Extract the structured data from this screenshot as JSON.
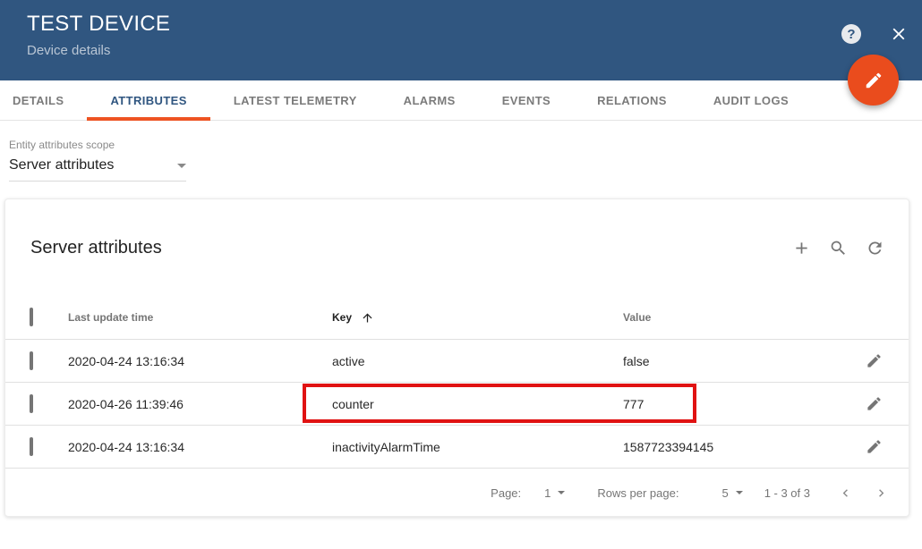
{
  "header": {
    "title": "TEST DEVICE",
    "subtitle": "Device details"
  },
  "tabs": [
    {
      "label": "DETAILS",
      "active": false
    },
    {
      "label": "ATTRIBUTES",
      "active": true
    },
    {
      "label": "LATEST TELEMETRY",
      "active": false
    },
    {
      "label": "ALARMS",
      "active": false
    },
    {
      "label": "EVENTS",
      "active": false
    },
    {
      "label": "RELATIONS",
      "active": false
    },
    {
      "label": "AUDIT LOGS",
      "active": false
    }
  ],
  "scope": {
    "label": "Entity attributes scope",
    "value": "Server attributes"
  },
  "card": {
    "title": "Server attributes"
  },
  "table": {
    "columns": {
      "time": "Last update time",
      "key": "Key",
      "value": "Value"
    },
    "sorted_by": "Key",
    "sort_direction": "asc",
    "rows": [
      {
        "time": "2020-04-24 13:16:34",
        "key": "active",
        "value": "false"
      },
      {
        "time": "2020-04-26 11:39:46",
        "key": "counter",
        "value": "777",
        "highlighted": true
      },
      {
        "time": "2020-04-24 13:16:34",
        "key": "inactivityAlarmTime",
        "value": "1587723394145"
      }
    ]
  },
  "pagination": {
    "page_label": "Page:",
    "page_value": "1",
    "rows_per_page_label": "Rows per page:",
    "rows_per_page_value": "5",
    "range_label": "1 - 3 of 3"
  },
  "icons": {
    "help": "?",
    "close": "close-x",
    "edit_fab": "pencil",
    "add": "plus",
    "search": "magnifier",
    "refresh": "circular-arrow",
    "sort": "arrow-up",
    "row_edit": "pencil",
    "prev": "chevron-left",
    "next": "chevron-right"
  },
  "colors": {
    "header_bg": "#305680",
    "accent_orange": "#ea4c1d",
    "tab_indicator": "#ee5322",
    "annotation_red": "#e01212",
    "icon_gray": "#757575"
  }
}
